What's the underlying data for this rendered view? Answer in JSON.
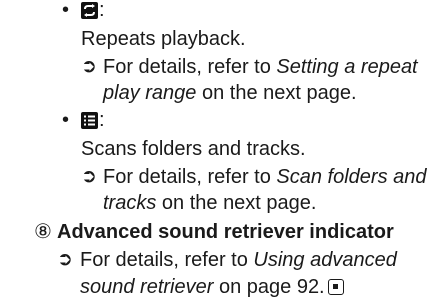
{
  "bullets": {
    "repeat": {
      "icon": "repeat-icon",
      "colon": ":",
      "desc": "Repeats playback.",
      "ref_prefix": "For details, refer to ",
      "ref_link_1": "Setting a repeat",
      "ref_link_2": "play range",
      "ref_suffix": " on the next page."
    },
    "scan": {
      "icon": "scan-list-icon",
      "colon": ":",
      "desc": "Scans folders and tracks.",
      "ref_prefix": "For details, refer to ",
      "ref_link_1": "Scan folders and",
      "ref_link_2": "tracks",
      "ref_suffix": " on the next page."
    }
  },
  "item8": {
    "number": "⑧",
    "heading": "Advanced sound retriever indicator",
    "ref_prefix": "For details, refer to ",
    "ref_link_1": "Using advanced",
    "ref_link_2": "sound retriever",
    "ref_suffix": " on page 92."
  },
  "arrow_glyph": "➲"
}
